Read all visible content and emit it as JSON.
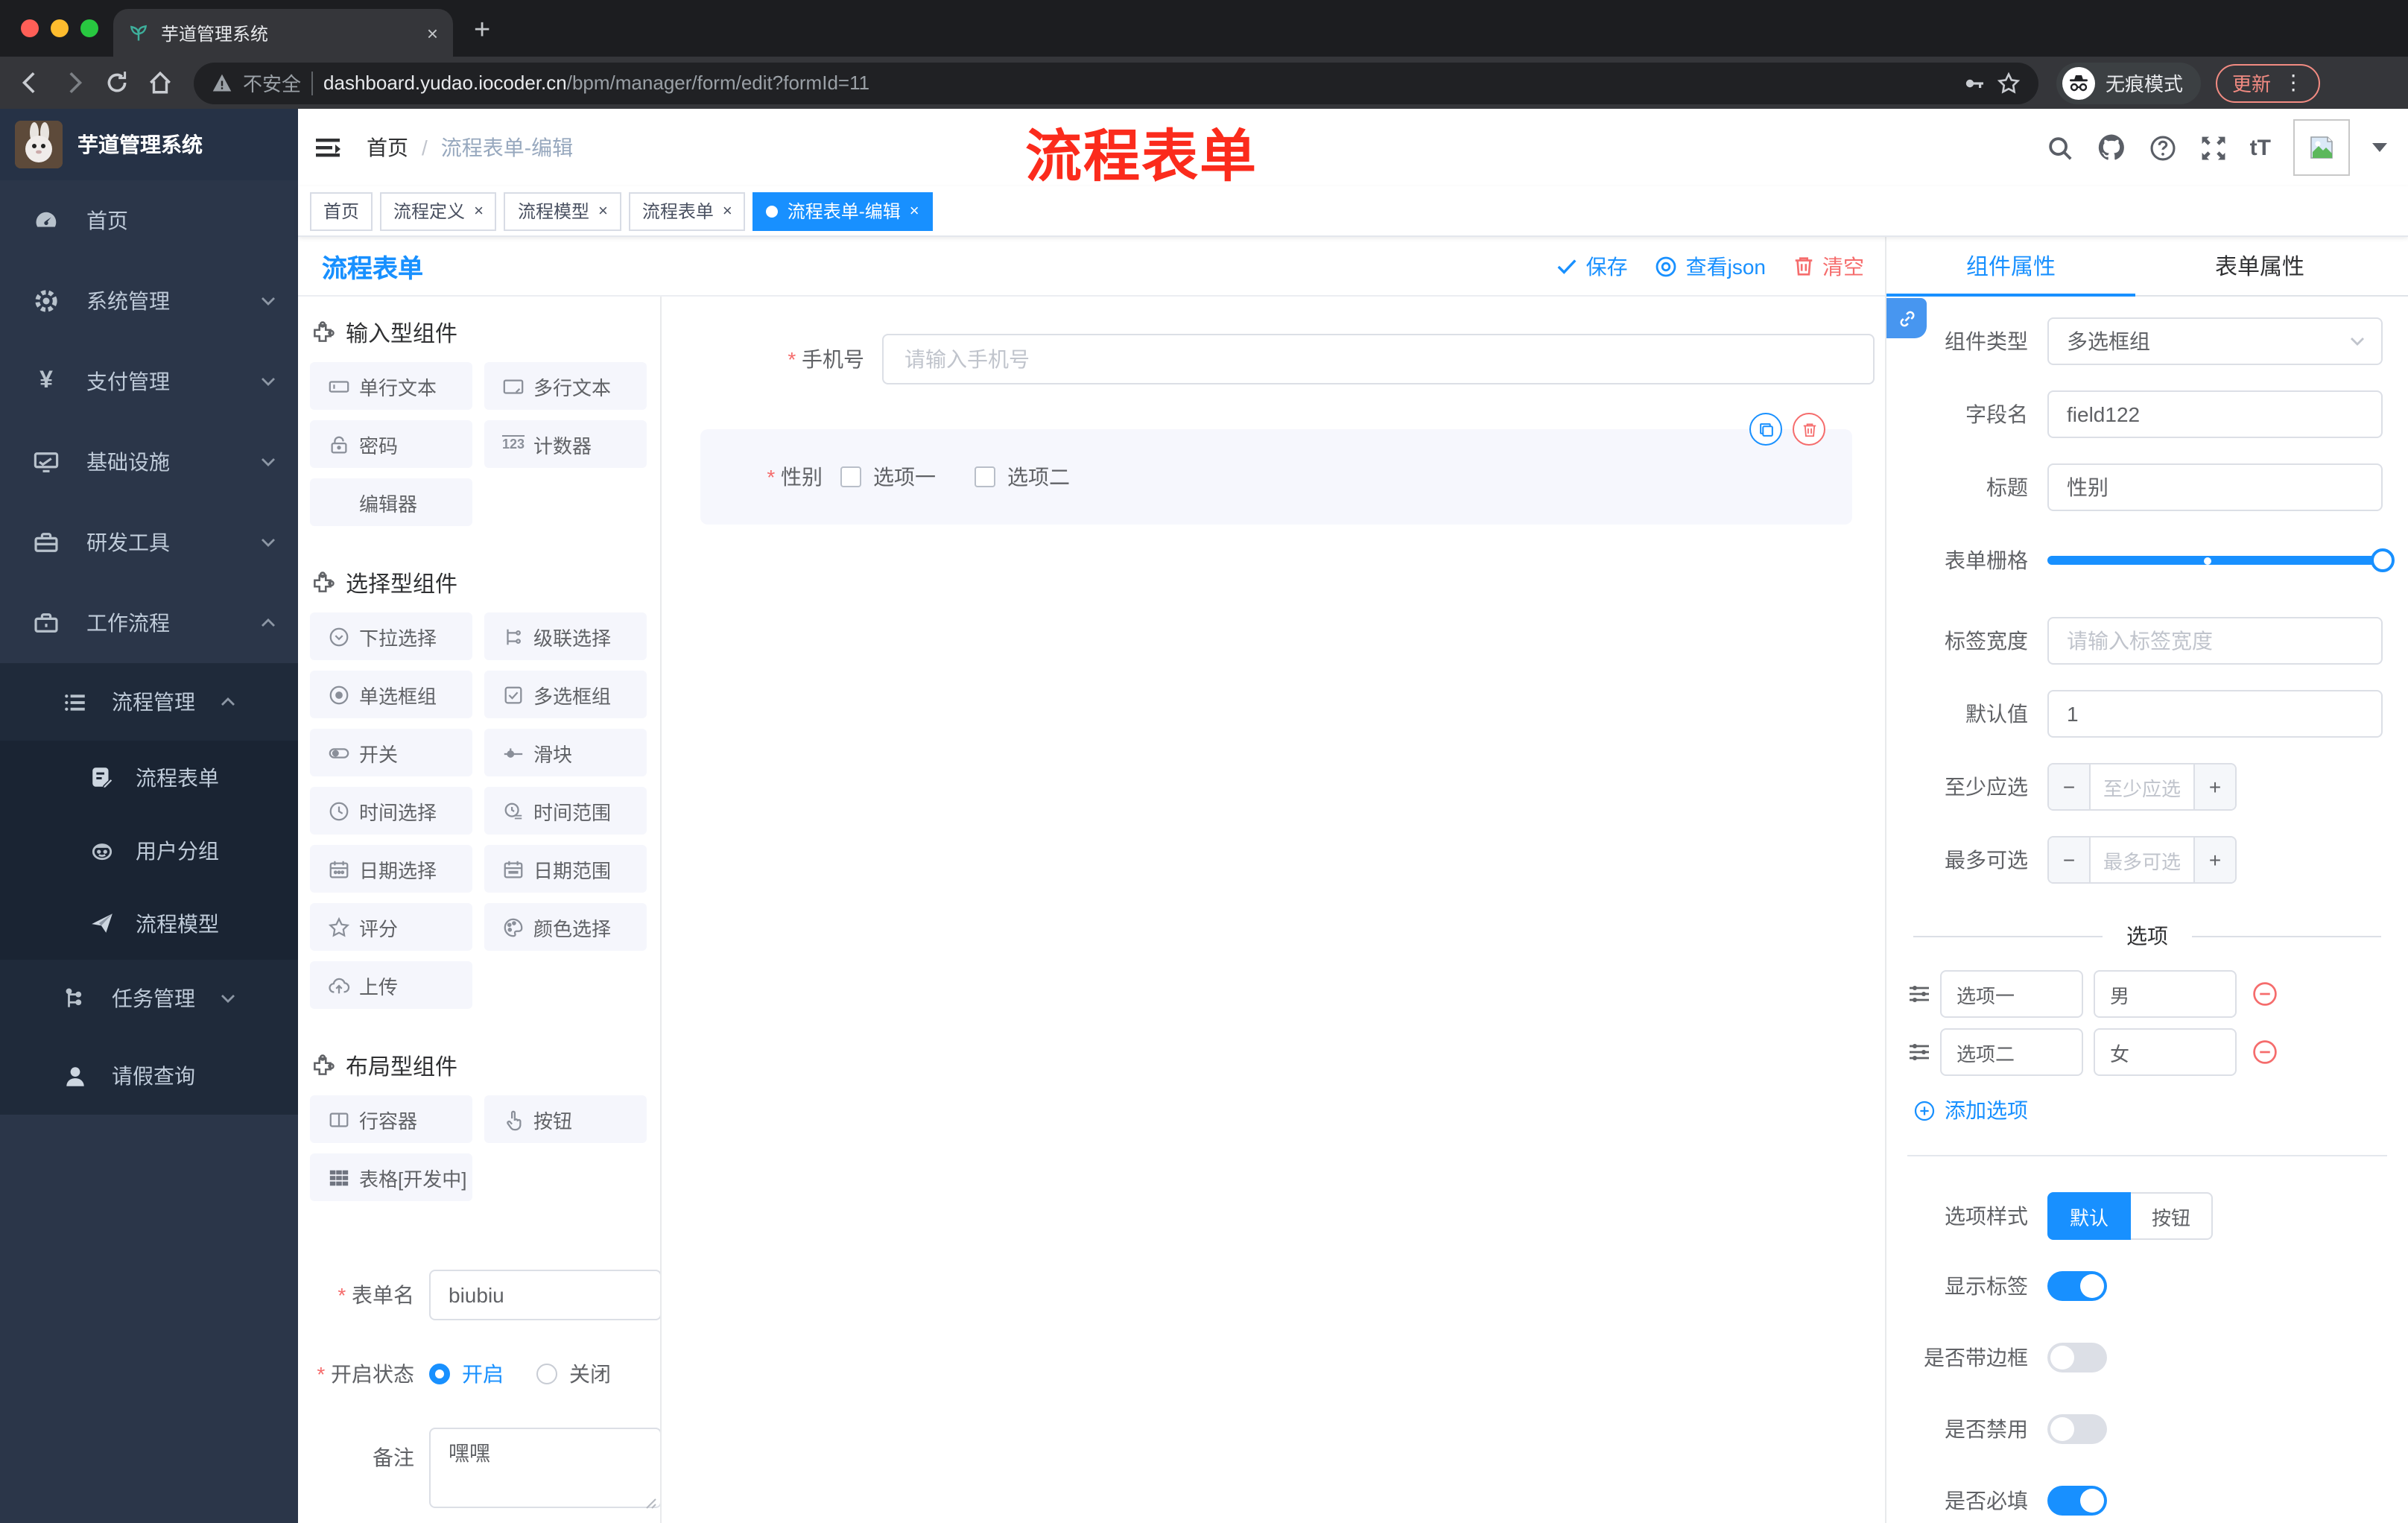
{
  "ui": {
    "close": "×",
    "slash": "/",
    "plus": "+",
    "minus": "−",
    "kebab": "⋮"
  },
  "colors": {
    "accent": "#1890ff",
    "danger": "#f56c6c",
    "annotation": "#fb2b1c",
    "sidebar_bg": "#2b3649",
    "sidebar_submenu_bg": "#1f2a3a",
    "chip_bg": "#f5f6fc",
    "active_tag_bg": "#1890ff"
  },
  "browser": {
    "tab_title": "芋道管理系统",
    "security_label": "不安全",
    "url_host": "dashboard.yudao.iocoder.cn",
    "url_path": "/bpm/manager/form/edit?formId=11",
    "incognito_label": "无痕模式",
    "update_label": "更新"
  },
  "sidebar": {
    "logo_title": "芋道管理系统",
    "items": [
      {
        "label": "首页"
      },
      {
        "label": "系统管理"
      },
      {
        "label": "支付管理"
      },
      {
        "label": "基础设施"
      },
      {
        "label": "研发工具"
      },
      {
        "label": "工作流程"
      }
    ],
    "submenu": [
      {
        "label": "流程管理"
      },
      {
        "label": "流程表单"
      },
      {
        "label": "用户分组"
      },
      {
        "label": "流程模型"
      },
      {
        "label": "任务管理"
      },
      {
        "label": "请假查询"
      }
    ]
  },
  "header": {
    "breadcrumb": [
      "首页",
      "流程表单-编辑"
    ],
    "annotation": "流程表单"
  },
  "tags": [
    {
      "label": "首页"
    },
    {
      "label": "流程定义"
    },
    {
      "label": "流程模型"
    },
    {
      "label": "流程表单"
    },
    {
      "label": "流程表单-编辑"
    }
  ],
  "editor": {
    "title": "流程表单",
    "save": "保存",
    "view_json": "查看json",
    "clear": "清空"
  },
  "palette": {
    "groups": [
      {
        "title": "输入型组件",
        "items": [
          "单行文本",
          "多行文本",
          "密码",
          "计数器",
          "编辑器"
        ]
      },
      {
        "title": "选择型组件",
        "items": [
          "下拉选择",
          "级联选择",
          "单选框组",
          "多选框组",
          "开关",
          "滑块",
          "时间选择",
          "时间范围",
          "日期选择",
          "日期范围",
          "评分",
          "颜色选择",
          "上传"
        ]
      },
      {
        "title": "布局型组件",
        "items": [
          "行容器",
          "按钮",
          "表格[开发中]"
        ]
      }
    ],
    "form": {
      "name_label": "表单名",
      "name_value": "biubiu",
      "status_label": "开启状态",
      "status_on": "开启",
      "status_off": "关闭",
      "remark_label": "备注",
      "remark_value": "嘿嘿"
    }
  },
  "canvas": {
    "phone": {
      "label": "手机号",
      "placeholder": "请输入手机号"
    },
    "gender": {
      "label": "性别",
      "option1": "选项一",
      "option2": "选项二"
    }
  },
  "properties": {
    "tab_component": "组件属性",
    "tab_form": "表单属性",
    "component_type_label": "组件类型",
    "component_type_value": "多选框组",
    "field_name_label": "字段名",
    "field_name_value": "field122",
    "title_label": "标题",
    "title_value": "性别",
    "grid_label": "表单栅格",
    "label_width_label": "标签宽度",
    "label_width_placeholder": "请输入标签宽度",
    "default_label": "默认值",
    "default_value": "1",
    "min_label": "至少应选",
    "min_placeholder": "至少应选",
    "max_label": "最多可选",
    "max_placeholder": "最多可选",
    "options_title": "选项",
    "options": [
      {
        "name": "选项一",
        "value": "男"
      },
      {
        "name": "选项二",
        "value": "女"
      }
    ],
    "add_option": "添加选项",
    "style_label": "选项样式",
    "style_default": "默认",
    "style_button": "按钮",
    "show_label": "显示标签",
    "border_label": "是否带边框",
    "disabled_label": "是否禁用",
    "required_label": "是否必填"
  }
}
